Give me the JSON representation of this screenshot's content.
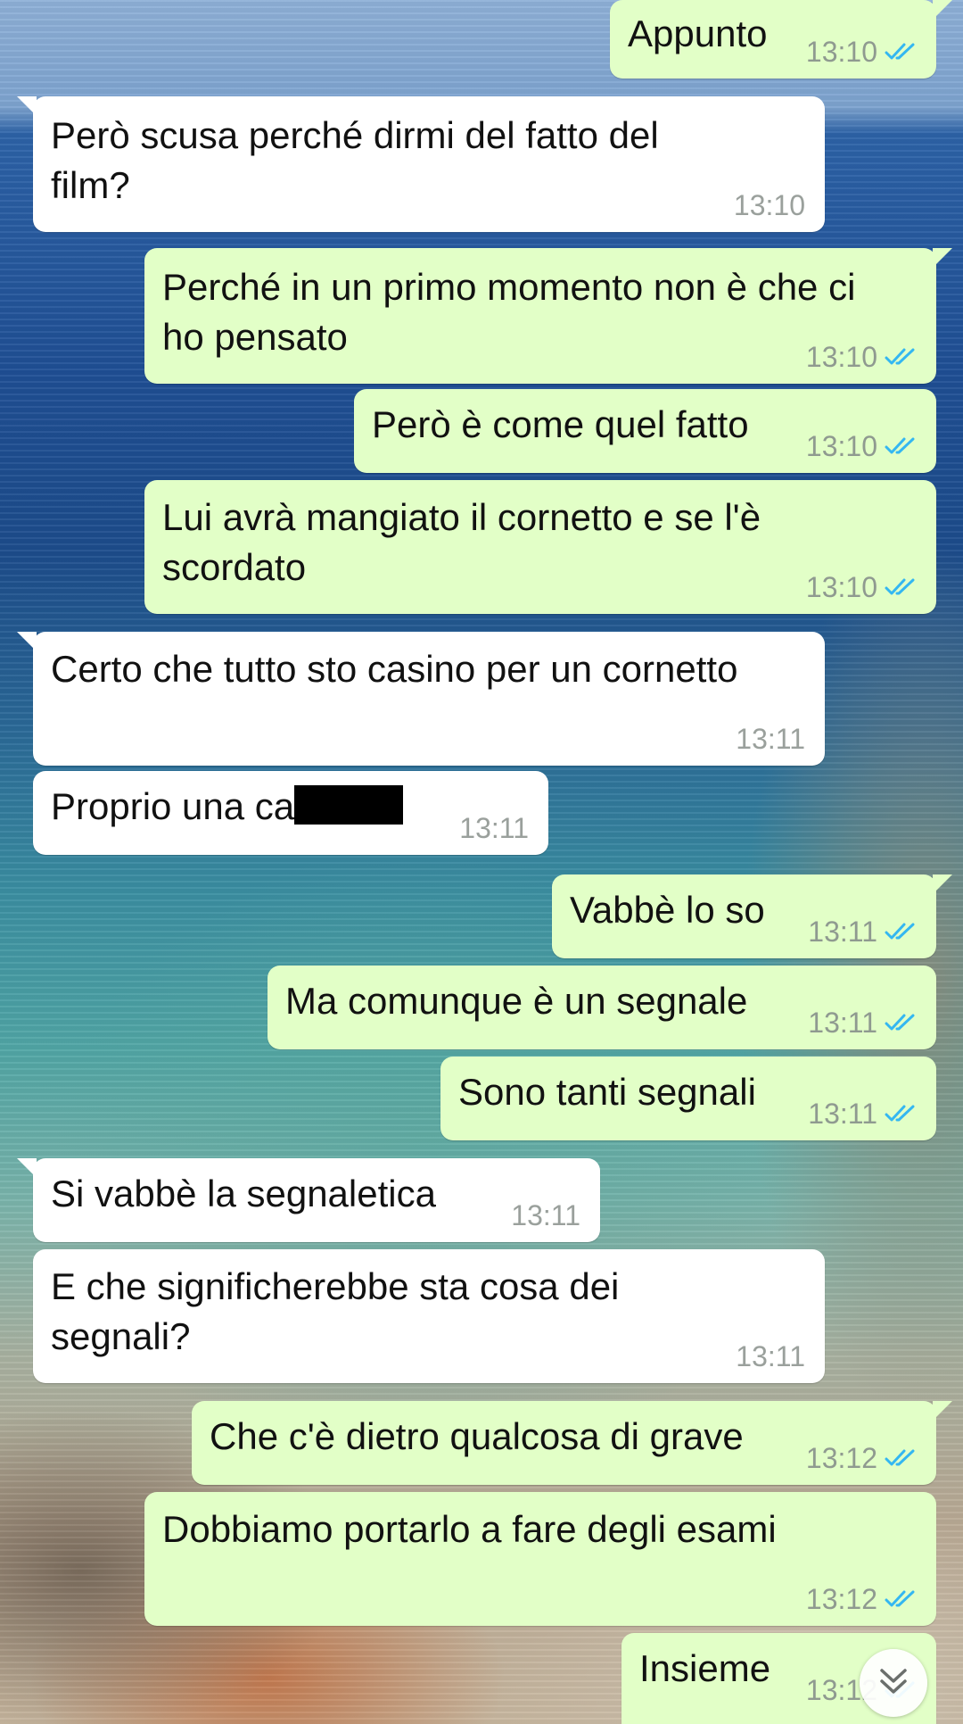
{
  "messages": [
    {
      "text": "Appunto",
      "time": "13:10",
      "direction": "out",
      "status": "read"
    },
    {
      "text": "Però scusa perché dirmi del fatto del\nfilm?",
      "time": "13:10",
      "direction": "in"
    },
    {
      "text": "Perché in un primo momento non è che ci\nho pensato",
      "time": "13:10",
      "direction": "out",
      "status": "read"
    },
    {
      "text": "Però è come quel fatto",
      "time": "13:10",
      "direction": "out",
      "status": "read"
    },
    {
      "text": "Lui avrà mangiato il cornetto e se l'è\nscordato",
      "time": "13:10",
      "direction": "out",
      "status": "read"
    },
    {
      "text": "Certo che tutto sto casino per un cornetto",
      "time": "13:11",
      "direction": "in"
    },
    {
      "text": "Proprio una ca",
      "time": "13:11",
      "direction": "in",
      "redacted": true
    },
    {
      "text": "Vabbè lo so",
      "time": "13:11",
      "direction": "out",
      "status": "read"
    },
    {
      "text": "Ma comunque è un segnale",
      "time": "13:11",
      "direction": "out",
      "status": "read"
    },
    {
      "text": "Sono tanti segnali",
      "time": "13:11",
      "direction": "out",
      "status": "read"
    },
    {
      "text": "Si vabbè la segnaletica",
      "time": "13:11",
      "direction": "in"
    },
    {
      "text": "E che significherebbe sta cosa dei\nsegnali?",
      "time": "13:11",
      "direction": "in"
    },
    {
      "text": "Che c'è dietro qualcosa di grave",
      "time": "13:12",
      "direction": "out",
      "status": "read"
    },
    {
      "text": "Dobbiamo portarlo a fare degli esami",
      "time": "13:12",
      "direction": "out",
      "status": "read"
    },
    {
      "text": "Insieme",
      "time": "13:12",
      "direction": "out",
      "status": "read"
    }
  ],
  "icons": {
    "read_ticks": "double-check-icon",
    "scroll_down": "chevron-double-down-icon"
  },
  "colors": {
    "outgoing_bubble": "#e2ffc7",
    "incoming_bubble": "#ffffff",
    "read_tick": "#34b7f1",
    "timestamp": "#8f9a90"
  }
}
